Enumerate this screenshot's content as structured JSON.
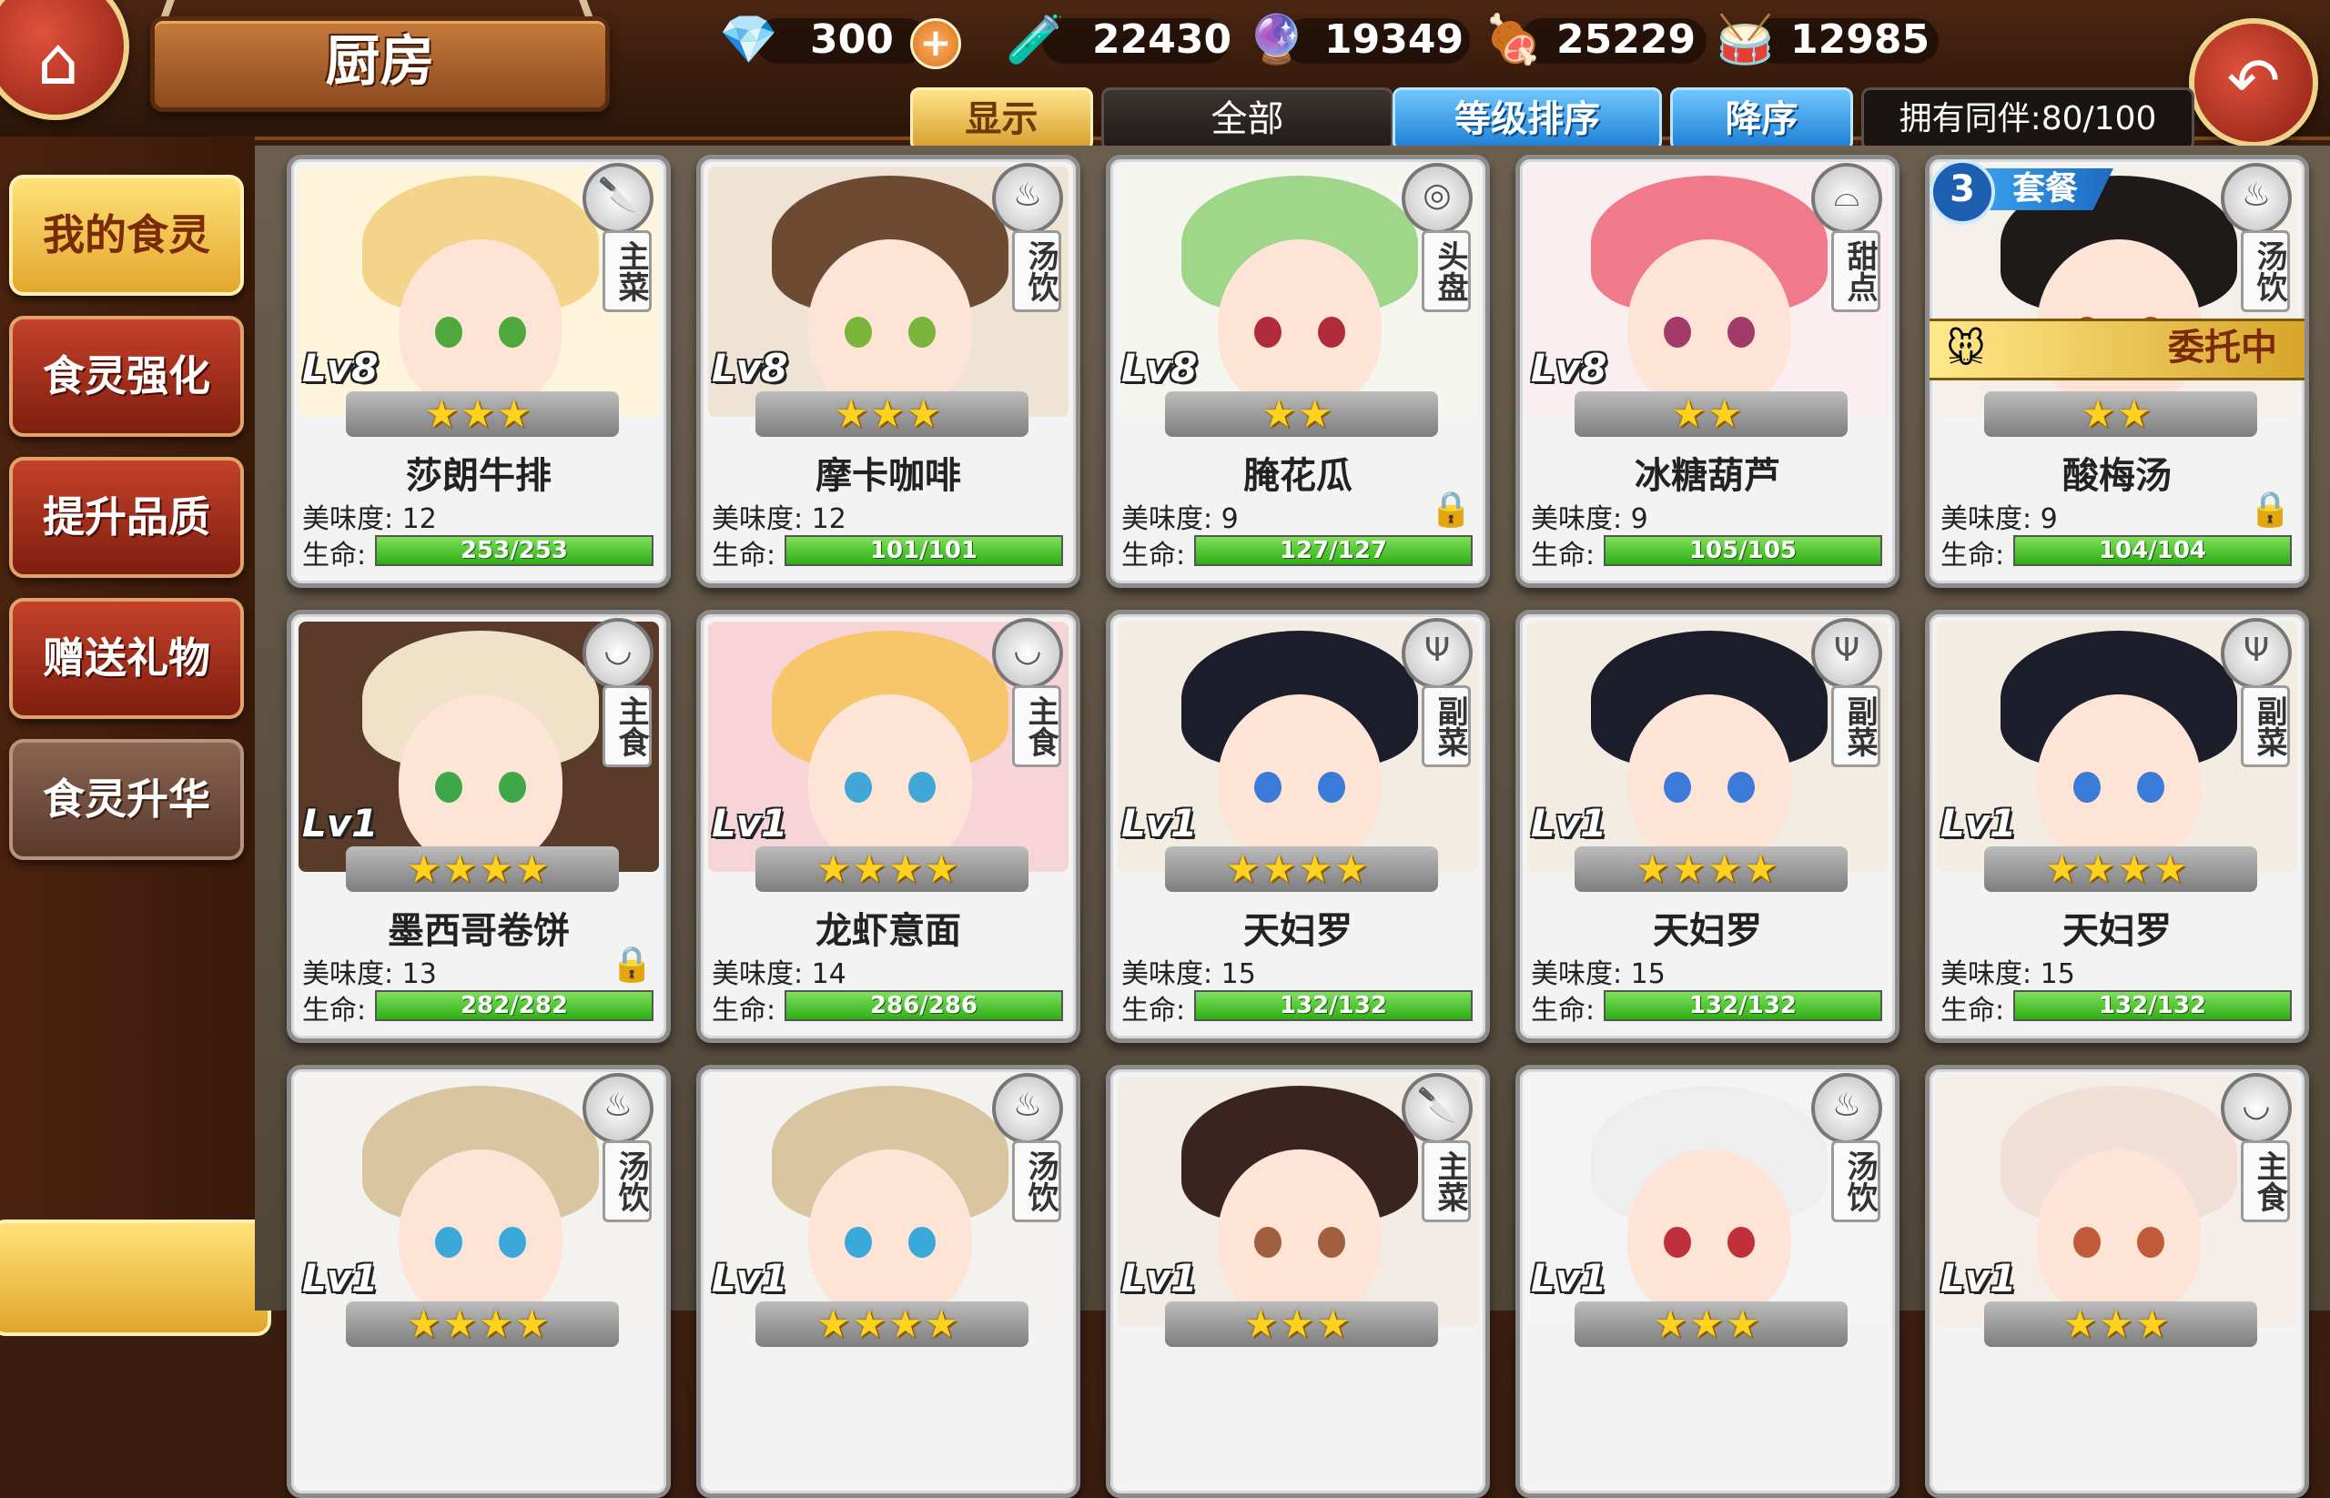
{
  "header": {
    "title": "厨房",
    "resources": [
      {
        "icon": "diamond-icon",
        "glyph": "💎",
        "value": "300"
      },
      {
        "icon": "potion-icon",
        "glyph": "🧪",
        "value": "22430"
      },
      {
        "icon": "crystal-icon",
        "glyph": "🔮",
        "value": "19349"
      },
      {
        "icon": "meat-icon",
        "glyph": "🍖",
        "value": "25229"
      },
      {
        "icon": "drum-icon",
        "glyph": "🥁",
        "value": "12985"
      }
    ],
    "plus_label": "+"
  },
  "filters": {
    "display_label": "显示",
    "all_label": "全部",
    "sort_level_label": "等级排序",
    "order_label": "降序",
    "owned_label": "拥有同伴:80/100"
  },
  "sidebar": {
    "items": [
      {
        "label": "我的食灵",
        "state": "active"
      },
      {
        "label": "食灵强化",
        "state": "normal"
      },
      {
        "label": "提升品质",
        "state": "normal"
      },
      {
        "label": "赠送礼物",
        "state": "normal"
      },
      {
        "label": "食灵升华",
        "state": "dim"
      }
    ]
  },
  "labels": {
    "taste_prefix": "美味度:",
    "hp_prefix": "生命:",
    "combo_text": "套餐",
    "delegated_text": "委托中"
  },
  "cards": [
    {
      "name": "莎朗牛排",
      "level": "Lv8",
      "stars": 3,
      "type": "主菜",
      "badge": "knife-icon",
      "taste": "12",
      "hp": "253/253",
      "hair": "#f3d48a",
      "eye": "#4fa83b",
      "bg": "#fff4dc",
      "locked": false
    },
    {
      "name": "摩卡咖啡",
      "level": "Lv8",
      "stars": 3,
      "type": "汤饮",
      "badge": "soup-icon",
      "taste": "12",
      "hp": "101/101",
      "hair": "#6d4a32",
      "eye": "#7ab43a",
      "bg": "#efe3d6",
      "locked": false
    },
    {
      "name": "腌花瓜",
      "level": "Lv8",
      "stars": 2,
      "type": "头盘",
      "badge": "plate-icon",
      "taste": "9",
      "hp": "127/127",
      "hair": "#9fd68a",
      "eye": "#b02c3a",
      "bg": "#f6f6f0",
      "locked": true
    },
    {
      "name": "冰糖葫芦",
      "level": "Lv8",
      "stars": 2,
      "type": "甜点",
      "badge": "cake-icon",
      "taste": "9",
      "hp": "105/105",
      "hair": "#f07a8a",
      "eye": "#a23a6a",
      "bg": "#fbeef0",
      "locked": false
    },
    {
      "name": "酸梅汤",
      "level": "",
      "stars": 2,
      "type": "汤饮",
      "badge": "soup-icon",
      "taste": "9",
      "hp": "104/104",
      "hair": "#1f1a1a",
      "eye": "#c23a1a",
      "bg": "#f4efe8",
      "locked": true,
      "combo": "3",
      "delegated": true
    },
    {
      "name": "墨西哥卷饼",
      "level": "Lv1",
      "stars": 4,
      "type": "主食",
      "badge": "bowl-icon",
      "taste": "13",
      "hp": "282/282",
      "hair": "#efe2c8",
      "eye": "#3ea848",
      "bg": "#5a3b2a",
      "locked": true
    },
    {
      "name": "龙虾意面",
      "level": "Lv1",
      "stars": 4,
      "type": "主食",
      "badge": "bowl-icon",
      "taste": "14",
      "hp": "286/286",
      "hair": "#f7c66a",
      "eye": "#3fa8d8",
      "bg": "#f7d4d8",
      "locked": false
    },
    {
      "name": "天妇罗",
      "level": "Lv1",
      "stars": 4,
      "type": "副菜",
      "badge": "fork-icon",
      "taste": "15",
      "hp": "132/132",
      "hair": "#1b1d2a",
      "eye": "#3a7ad8",
      "bg": "#f2ece2",
      "locked": false
    },
    {
      "name": "天妇罗",
      "level": "Lv1",
      "stars": 4,
      "type": "副菜",
      "badge": "fork-icon",
      "taste": "15",
      "hp": "132/132",
      "hair": "#1b1d2a",
      "eye": "#3a7ad8",
      "bg": "#f2ece2",
      "locked": false
    },
    {
      "name": "天妇罗",
      "level": "Lv1",
      "stars": 4,
      "type": "副菜",
      "badge": "fork-icon",
      "taste": "15",
      "hp": "132/132",
      "hair": "#1b1d2a",
      "eye": "#3a7ad8",
      "bg": "#f2ece2",
      "locked": false
    },
    {
      "name": "",
      "level": "Lv1",
      "stars": 4,
      "type": "汤饮",
      "badge": "soup-icon",
      "taste": "",
      "hp": "",
      "hair": "#d9c6a0",
      "eye": "#3aa8d8",
      "bg": "#f4f2ee",
      "locked": false
    },
    {
      "name": "",
      "level": "Lv1",
      "stars": 4,
      "type": "汤饮",
      "badge": "soup-icon",
      "taste": "",
      "hp": "",
      "hair": "#d9c6a0",
      "eye": "#3aa8d8",
      "bg": "#f4f2ee",
      "locked": false
    },
    {
      "name": "",
      "level": "Lv1",
      "stars": 3,
      "type": "主菜",
      "badge": "knife-icon",
      "taste": "",
      "hp": "",
      "hair": "#3a2420",
      "eye": "#a06040",
      "bg": "#f2ece6",
      "locked": false
    },
    {
      "name": "",
      "level": "Lv1",
      "stars": 3,
      "type": "汤饮",
      "badge": "soup-icon",
      "taste": "",
      "hp": "",
      "hair": "#eeeeee",
      "eye": "#c0303a",
      "bg": "#f4f4f4",
      "locked": false
    },
    {
      "name": "",
      "level": "Lv1",
      "stars": 3,
      "type": "主食",
      "badge": "bowl-icon",
      "taste": "",
      "hp": "",
      "hair": "#f2e0d8",
      "eye": "#c05a3a",
      "bg": "#f4ede8",
      "locked": false
    }
  ]
}
